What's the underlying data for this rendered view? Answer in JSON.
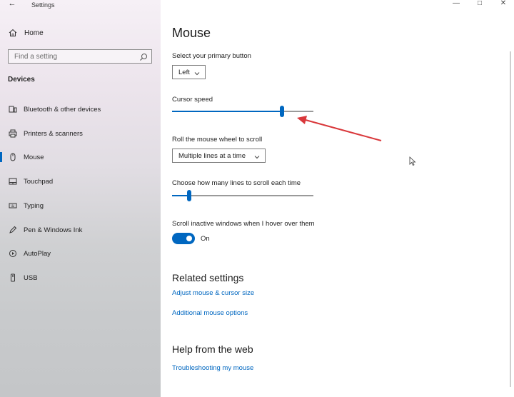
{
  "app": {
    "title": "Settings",
    "back_glyph": "←"
  },
  "window_controls": {
    "minimize": "—",
    "maximize": "□",
    "close": "✕"
  },
  "sidebar": {
    "home_label": "Home",
    "search_placeholder": "Find a setting",
    "section_title": "Devices",
    "items": [
      {
        "label": "Bluetooth & other devices",
        "icon": "bluetooth-devices-icon"
      },
      {
        "label": "Printers & scanners",
        "icon": "printer-icon"
      },
      {
        "label": "Mouse",
        "icon": "mouse-icon",
        "active": true
      },
      {
        "label": "Touchpad",
        "icon": "touchpad-icon"
      },
      {
        "label": "Typing",
        "icon": "keyboard-icon"
      },
      {
        "label": "Pen & Windows Ink",
        "icon": "pen-icon"
      },
      {
        "label": "AutoPlay",
        "icon": "autoplay-icon"
      },
      {
        "label": "USB",
        "icon": "usb-icon"
      }
    ]
  },
  "main": {
    "title": "Mouse",
    "primary_button": {
      "label": "Select your primary button",
      "value": "Left"
    },
    "cursor_speed": {
      "label": "Cursor speed",
      "level_fraction": 0.78
    },
    "wheel_scroll": {
      "label": "Roll the mouse wheel to scroll",
      "value": "Multiple lines at a time"
    },
    "lines_to_scroll": {
      "label": "Choose how many lines to scroll each time",
      "level_fraction": 0.12
    },
    "inactive_scroll": {
      "label": "Scroll inactive windows when I hover over them",
      "state": "On"
    },
    "related": {
      "title": "Related settings",
      "links": [
        "Adjust mouse & cursor size",
        "Additional mouse options"
      ]
    },
    "help": {
      "title": "Help from the web",
      "links": [
        "Troubleshooting my mouse"
      ]
    }
  },
  "colors": {
    "accent": "#0067c0",
    "annotation_arrow": "#d9373a"
  }
}
